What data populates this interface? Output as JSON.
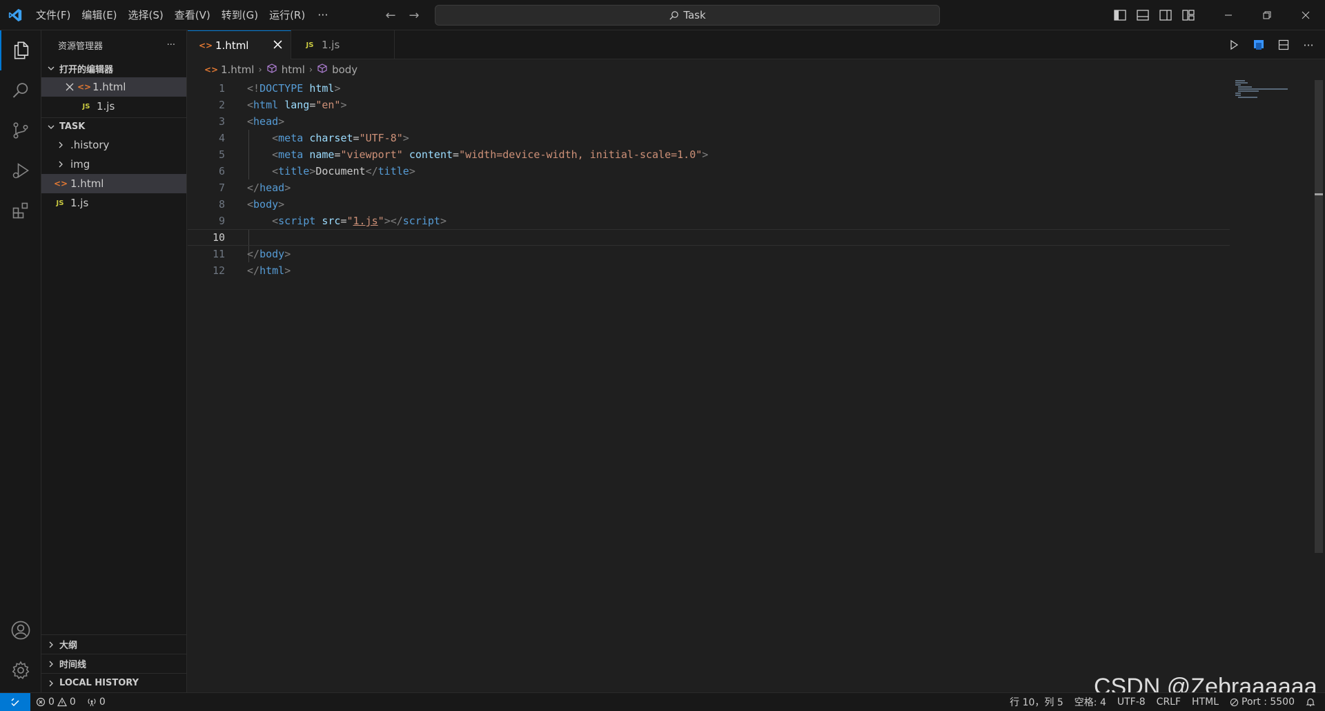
{
  "titlebar": {
    "menu": [
      "文件(F)",
      "编辑(E)",
      "选择(S)",
      "查看(V)",
      "转到(G)",
      "运行(R)"
    ],
    "more": "···",
    "search_text": "Task"
  },
  "sidebar": {
    "title": "资源管理器",
    "more": "···",
    "open_editors": {
      "title": "打开的编辑器",
      "items": [
        {
          "name": "1.html",
          "type": "html",
          "selected": true
        },
        {
          "name": "1.js",
          "type": "js",
          "selected": false
        }
      ]
    },
    "folder": {
      "title": "TASK",
      "items": [
        {
          "name": ".history",
          "type": "folder"
        },
        {
          "name": "img",
          "type": "folder"
        },
        {
          "name": "1.html",
          "type": "html",
          "selected": true
        },
        {
          "name": "1.js",
          "type": "js"
        }
      ]
    },
    "bottom_sections": [
      "大纲",
      "时间线",
      "LOCAL HISTORY"
    ]
  },
  "tabs": [
    {
      "name": "1.html",
      "type": "html",
      "active": true
    },
    {
      "name": "1.js",
      "type": "js",
      "active": false
    }
  ],
  "breadcrumb": [
    "1.html",
    "html",
    "body"
  ],
  "editor": {
    "lines": [
      {
        "n": "1",
        "tokens": [
          [
            "punc",
            "<!"
          ],
          [
            "doctype",
            "DOCTYPE "
          ],
          [
            "attr",
            "html"
          ],
          [
            "punc",
            ">"
          ]
        ]
      },
      {
        "n": "2",
        "tokens": [
          [
            "punc",
            "<"
          ],
          [
            "tag",
            "html "
          ],
          [
            "attr",
            "lang"
          ],
          [
            "text",
            "="
          ],
          [
            "str",
            "\"en\""
          ],
          [
            "punc",
            ">"
          ]
        ]
      },
      {
        "n": "3",
        "tokens": [
          [
            "punc",
            "<"
          ],
          [
            "tag",
            "head"
          ],
          [
            "punc",
            ">"
          ]
        ]
      },
      {
        "n": "4",
        "tokens": [
          [
            "text",
            "    "
          ],
          [
            "punc",
            "<"
          ],
          [
            "tag",
            "meta "
          ],
          [
            "attr",
            "charset"
          ],
          [
            "text",
            "="
          ],
          [
            "str",
            "\"UTF-8\""
          ],
          [
            "punc",
            ">"
          ]
        ]
      },
      {
        "n": "5",
        "tokens": [
          [
            "text",
            "    "
          ],
          [
            "punc",
            "<"
          ],
          [
            "tag",
            "meta "
          ],
          [
            "attr",
            "name"
          ],
          [
            "text",
            "="
          ],
          [
            "str",
            "\"viewport\" "
          ],
          [
            "attr",
            "content"
          ],
          [
            "text",
            "="
          ],
          [
            "str",
            "\"width=device-width, initial-scale=1.0\""
          ],
          [
            "punc",
            ">"
          ]
        ]
      },
      {
        "n": "6",
        "tokens": [
          [
            "text",
            "    "
          ],
          [
            "punc",
            "<"
          ],
          [
            "tag",
            "title"
          ],
          [
            "punc",
            ">"
          ],
          [
            "text",
            "Document"
          ],
          [
            "punc",
            "</"
          ],
          [
            "tag",
            "title"
          ],
          [
            "punc",
            ">"
          ]
        ]
      },
      {
        "n": "7",
        "tokens": [
          [
            "punc",
            "</"
          ],
          [
            "tag",
            "head"
          ],
          [
            "punc",
            ">"
          ]
        ]
      },
      {
        "n": "8",
        "tokens": [
          [
            "punc",
            "<"
          ],
          [
            "tag",
            "body"
          ],
          [
            "punc",
            ">"
          ]
        ]
      },
      {
        "n": "9",
        "tokens": [
          [
            "text",
            "    "
          ],
          [
            "punc",
            "<"
          ],
          [
            "tag",
            "script "
          ],
          [
            "attr",
            "src"
          ],
          [
            "text",
            "="
          ],
          [
            "str",
            "\""
          ],
          [
            "link",
            "1.js"
          ],
          [
            "str",
            "\""
          ],
          [
            "punc",
            "></"
          ],
          [
            "tag",
            "script"
          ],
          [
            "punc",
            ">"
          ]
        ]
      },
      {
        "n": "10",
        "tokens": [],
        "current": true
      },
      {
        "n": "11",
        "tokens": [
          [
            "punc",
            "</"
          ],
          [
            "tag",
            "body"
          ],
          [
            "punc",
            ">"
          ]
        ]
      },
      {
        "n": "12",
        "tokens": [
          [
            "punc",
            "</"
          ],
          [
            "tag",
            "html"
          ],
          [
            "punc",
            ">"
          ]
        ]
      }
    ]
  },
  "statusbar": {
    "errors": "0",
    "warnings": "0",
    "ports": "0",
    "position": "行 10，列 5",
    "spaces": "空格: 4",
    "encoding": "UTF-8",
    "eol": "CRLF",
    "language": "HTML",
    "port": "Port : 5500"
  },
  "watermark": "CSDN @Zebraaaaaa",
  "colors": {
    "accent": "#0078d4",
    "html_icon": "#e37933",
    "js_icon": "#cbcb41"
  }
}
